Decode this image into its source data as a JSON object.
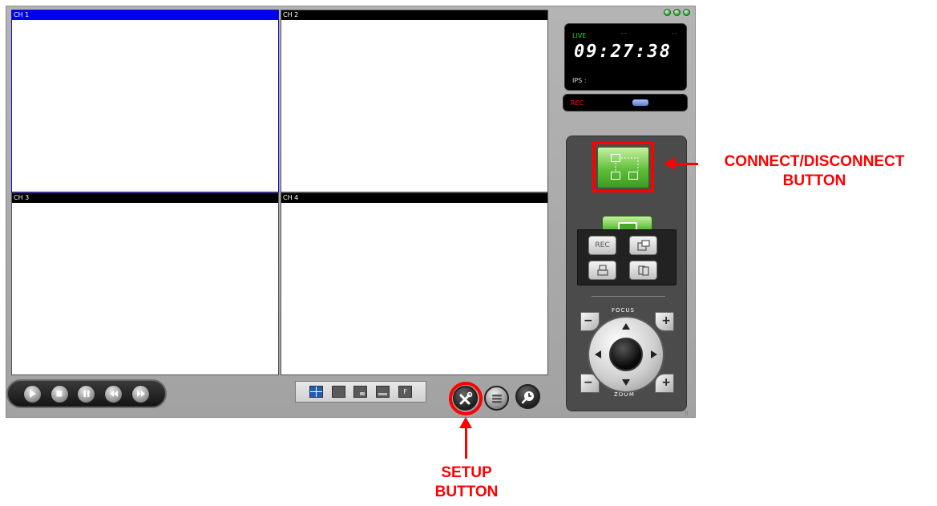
{
  "window": {
    "controls": [
      "minimize-icon",
      "maximize-icon",
      "close-icon"
    ]
  },
  "channels": [
    {
      "label": "CH 1",
      "active": true
    },
    {
      "label": "CH 2",
      "active": false
    },
    {
      "label": "CH 3",
      "active": false
    },
    {
      "label": "CH 4",
      "active": false
    }
  ],
  "status": {
    "live_label": "LIVE",
    "dots_left": "- -",
    "dots_right": "- -",
    "clock": "09:27:38",
    "ips_label": "IPS :",
    "rec_label": "REC"
  },
  "controls": {
    "rec_button": "REC",
    "focus_label": "FOCUS",
    "zoom_label": "ZOOM",
    "minus": "−",
    "plus": "+"
  },
  "playback": [
    "play-icon",
    "stop-icon",
    "pause-icon",
    "rewind-icon",
    "fast-forward-icon"
  ],
  "layout_buttons": [
    "quad-view-icon",
    "single-view-icon",
    "pip-view-icon",
    "wide-view-icon",
    "fullscreen-f-icon"
  ],
  "layout_f_label": "F",
  "annotations": {
    "connect": "CONNECT/DISCONNECT\nBUTTON",
    "connect_line1": "CONNECT/DISCONNECT",
    "connect_line2": "BUTTON",
    "setup_line1": "SETUP",
    "setup_line2": "BUTTON"
  },
  "colors": {
    "annotation": "#ff0000",
    "active_channel": "#0000ee",
    "connect_green": "#5fbf3a"
  }
}
